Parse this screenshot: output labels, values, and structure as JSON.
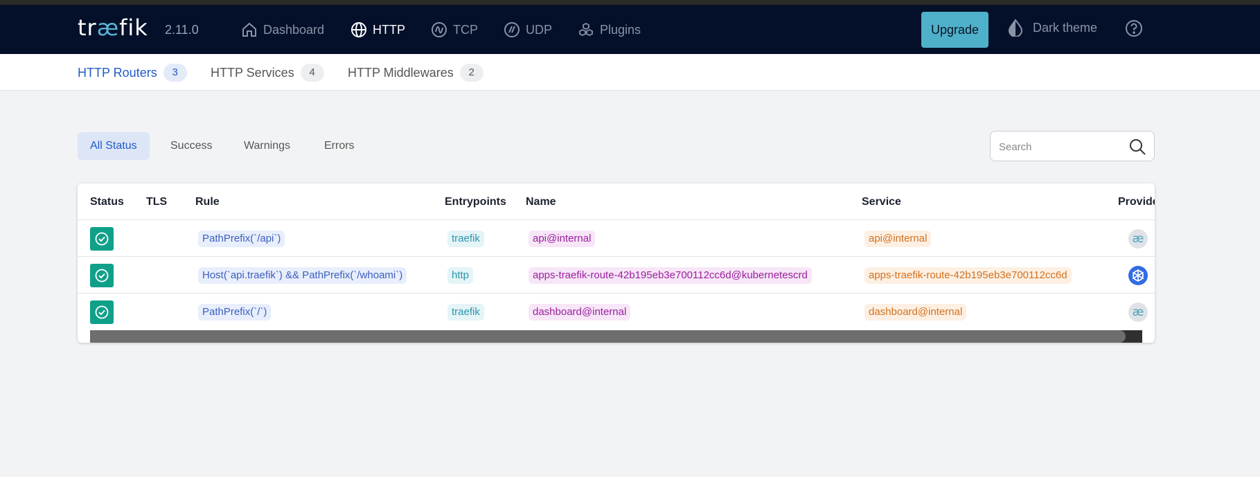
{
  "navbar": {
    "logo": {
      "pre": "tr",
      "mid": "æ",
      "post": "fik"
    },
    "version": "2.11.0",
    "links": [
      {
        "label": "Dashboard",
        "icon": "home-icon",
        "active": false
      },
      {
        "label": "HTTP",
        "icon": "globe-icon",
        "active": true
      },
      {
        "label": "TCP",
        "icon": "tcp-icon",
        "active": false
      },
      {
        "label": "UDP",
        "icon": "udp-icon",
        "active": false
      },
      {
        "label": "Plugins",
        "icon": "plugins-icon",
        "active": false
      }
    ],
    "upgrade_label": "Upgrade",
    "theme_label": "Dark theme",
    "help_icon": "help-icon"
  },
  "subtabs": [
    {
      "label": "HTTP Routers",
      "count": "3",
      "active": true
    },
    {
      "label": "HTTP Services",
      "count": "4",
      "active": false
    },
    {
      "label": "HTTP Middlewares",
      "count": "2",
      "active": false
    }
  ],
  "filters": [
    {
      "label": "All Status",
      "active": true
    },
    {
      "label": "Success",
      "active": false
    },
    {
      "label": "Warnings",
      "active": false
    },
    {
      "label": "Errors",
      "active": false
    }
  ],
  "search": {
    "placeholder": "Search",
    "value": ""
  },
  "table": {
    "headers": {
      "status": "Status",
      "tls": "TLS",
      "rule": "Rule",
      "entrypoints": "Entrypoints",
      "name": "Name",
      "service": "Service",
      "provider": "Provide"
    },
    "rows": [
      {
        "status": "success",
        "rule": "PathPrefix(`/api`)",
        "entrypoint": "traefik",
        "name": "api@internal",
        "service": "api@internal",
        "provider_icon": "internal-provider-icon",
        "provider_glyph": "æ"
      },
      {
        "status": "success",
        "rule": "Host(`api.traefik`) && PathPrefix(`/whoami`)",
        "entrypoint": "http",
        "name": "apps-traefik-route-42b195eb3e700112cc6d@kubernetescrd",
        "service": "apps-traefik-route-42b195eb3e700112cc6d",
        "provider_icon": "kubernetes-icon",
        "provider_glyph": ""
      },
      {
        "status": "success",
        "rule": "PathPrefix(`/`)",
        "entrypoint": "traefik",
        "name": "dashboard@internal",
        "service": "dashboard@internal",
        "provider_icon": "internal-provider-icon",
        "provider_glyph": "æ"
      }
    ]
  },
  "colors": {
    "navbar_bg": "#04102a",
    "accent": "#2159c9",
    "upgrade_bg": "#4fb0c9",
    "success": "#10a08a"
  }
}
